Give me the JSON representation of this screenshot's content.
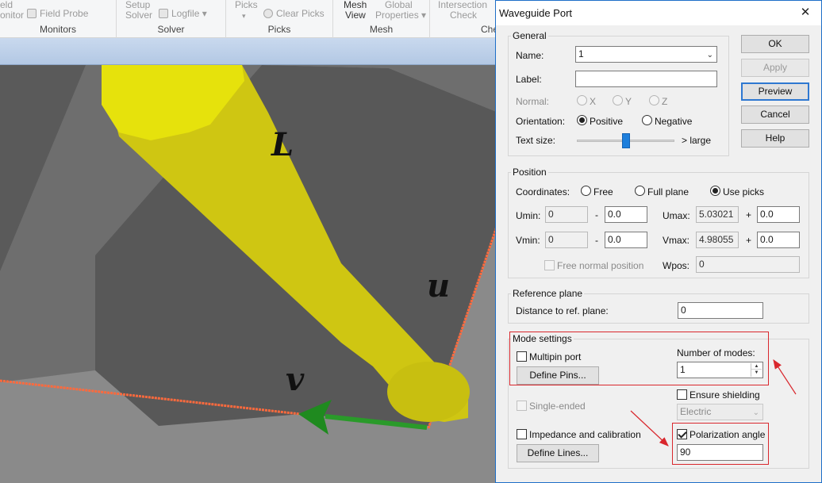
{
  "ribbon": {
    "groups": [
      {
        "label": "Monitors",
        "buttons": [
          "eld",
          "onitor",
          "Field Probe"
        ]
      },
      {
        "label": "Solver",
        "buttons": [
          "Setup",
          "Solver",
          "Logfile"
        ]
      },
      {
        "label": "Picks",
        "buttons": [
          "Picks",
          "Clear Picks"
        ]
      },
      {
        "label": "Mesh",
        "buttons": [
          "Mesh",
          "View",
          "Global",
          "Properties"
        ]
      },
      {
        "label": "Che",
        "buttons": [
          "Intersection",
          "Check"
        ]
      }
    ]
  },
  "viewport": {
    "axis_labels": {
      "l": "L",
      "u": "u",
      "v": "v"
    },
    "colors": {
      "cylinder": "#d3cb12",
      "background": "#6e6e6e",
      "face": "#585858",
      "port_edge": "#ff6a3d",
      "arrow": "#2a9a2a"
    }
  },
  "dialog": {
    "title": "Waveguide Port",
    "close_symbol": "✕",
    "general": {
      "group_label": "General",
      "name_label": "Name:",
      "name_value": "1",
      "label_label": "Label:",
      "label_value": "",
      "normal_label": "Normal:",
      "normal_options": [
        "X",
        "Y",
        "Z"
      ],
      "orientation_label": "Orientation:",
      "orientation_options": [
        "Positive",
        "Negative"
      ],
      "orientation_selected": "Positive",
      "textsize_label": "Text size:",
      "textsize_right": "> large",
      "textsize_value": 0.5
    },
    "position": {
      "group_label": "Position",
      "coords_label": "Coordinates:",
      "coords_options": [
        "Free",
        "Full plane",
        "Use picks"
      ],
      "coords_selected": "Use picks",
      "umin_label": "Umin:",
      "umin_value": "0",
      "umin_offset": "0.0",
      "umax_label": "Umax:",
      "umax_value": "5.03021",
      "umax_offset": "0.0",
      "vmin_label": "Vmin:",
      "vmin_value": "0",
      "vmin_offset": "0.0",
      "vmax_label": "Vmax:",
      "vmax_value": "4.98055",
      "vmax_offset": "0.0",
      "minus": "-",
      "plus": "+",
      "free_normal_label": "Free normal position",
      "wpos_label": "Wpos:",
      "wpos_value": "0"
    },
    "refplane": {
      "group_label": "Reference plane",
      "distance_label": "Distance to ref. plane:",
      "distance_value": "0"
    },
    "mode": {
      "group_label": "Mode settings",
      "multipin_label": "Multipin port",
      "define_pins_label": "Define Pins...",
      "num_modes_label": "Number of modes:",
      "num_modes_value": "1",
      "ensure_shielding_label": "Ensure shielding",
      "shield_type_value": "Electric",
      "single_ended_label": "Single-ended",
      "impedance_label": "Impedance and calibration",
      "define_lines_label": "Define Lines...",
      "polarization_label": "Polarization angle",
      "polarization_checked": true,
      "polarization_value": "90"
    },
    "buttons": {
      "ok": "OK",
      "apply": "Apply",
      "preview": "Preview",
      "cancel": "Cancel",
      "help": "Help"
    }
  }
}
